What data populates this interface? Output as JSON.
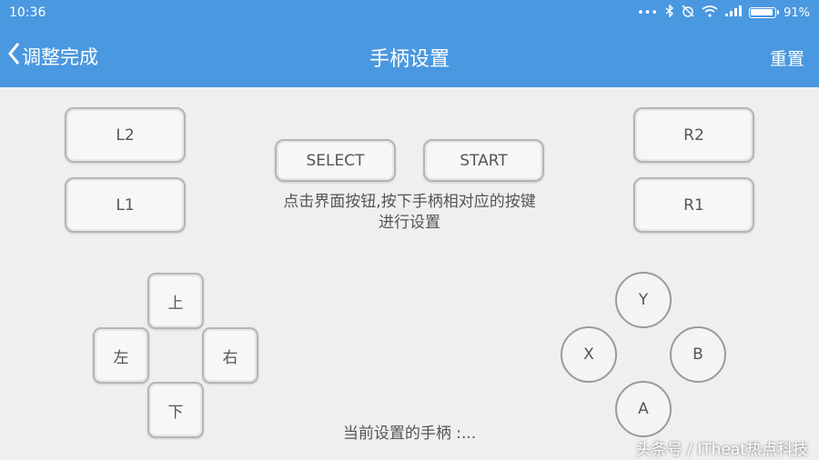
{
  "status": {
    "time": "10:36",
    "battery": "91%"
  },
  "appbar": {
    "back_label": "调整完成",
    "title": "手柄设置",
    "reset_label": "重置"
  },
  "buttons": {
    "l2": "L2",
    "l1": "L1",
    "r2": "R2",
    "r1": "R1",
    "select": "SELECT",
    "start": "START"
  },
  "instructions": {
    "line1": "点击界面按钮,按下手柄相对应的按键",
    "line2": "进行设置"
  },
  "dpad": {
    "up": "上",
    "down": "下",
    "left": "左",
    "right": "右"
  },
  "face": {
    "y": "Y",
    "x": "X",
    "b": "B",
    "a": "A"
  },
  "current_gamepad": "当前设置的手柄 :...",
  "watermark": "头条号 / ITheat热点科技"
}
